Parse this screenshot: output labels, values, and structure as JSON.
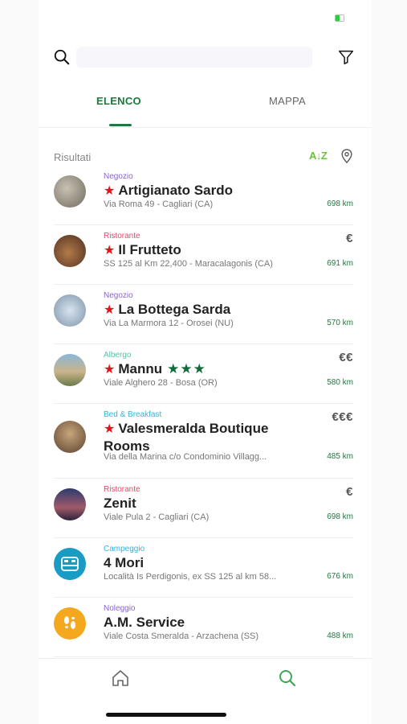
{
  "search": {
    "placeholder": ""
  },
  "tabs": [
    {
      "label": "ELENCO",
      "active": true
    },
    {
      "label": "MAPPA",
      "active": false
    }
  ],
  "results": {
    "label": "Risultati",
    "sort_label": "A↓Z"
  },
  "colors": {
    "accent": "#1c7a3e",
    "negozio": "#8a63d2",
    "ristorante": "#e14b6f",
    "albergo": "#5bc0a8",
    "bnb": "#36b3d9",
    "campeggio": "#36b3d9",
    "noleggio": "#8a63d2",
    "highlight_star": "#e3131b"
  },
  "items": [
    {
      "category": "Negozio",
      "name": "Artigianato Sardo",
      "featured": true,
      "hotel_stars": "",
      "address": "Via Roma 49 - Cagliari (CA)",
      "price": "",
      "distance": "698 km",
      "thumb": "photo"
    },
    {
      "category": "Ristorante",
      "name": "Il Frutteto",
      "featured": true,
      "hotel_stars": "",
      "address": "SS 125 al Km 22,400 - Maracalagonis (CA)",
      "price": "€",
      "distance": "691 km",
      "thumb": "photo"
    },
    {
      "category": "Negozio",
      "name": "La Bottega Sarda",
      "featured": true,
      "hotel_stars": "",
      "address": "Via La Marmora 12 - Orosei (NU)",
      "price": "",
      "distance": "570 km",
      "thumb": "photo"
    },
    {
      "category": "Albergo",
      "name": "Mannu",
      "featured": true,
      "hotel_stars": "★★★",
      "address": "Viale Alghero 28 - Bosa (OR)",
      "price": "€€",
      "distance": "580 km",
      "thumb": "photo"
    },
    {
      "category": "Bed & Breakfast",
      "name": "Valesmeralda Boutique Rooms",
      "featured": true,
      "hotel_stars": "",
      "address": "Via della Marina c/o Condominio Villagg...",
      "price": "€€€",
      "distance": "485 km",
      "thumb": "photo"
    },
    {
      "category": "Ristorante",
      "name": "Zenit",
      "featured": false,
      "hotel_stars": "",
      "address": "Viale Pula 2 - Cagliari (CA)",
      "price": "€",
      "distance": "698 km",
      "thumb": "photo"
    },
    {
      "category": "Campeggio",
      "name": "4 Mori",
      "featured": false,
      "hotel_stars": "",
      "address": "Località Is Perdigonis, ex SS 125 al km 58...",
      "price": "",
      "distance": "676 km",
      "thumb": "bed-icon"
    },
    {
      "category": "Noleggio",
      "name": "A.M. Service",
      "featured": false,
      "hotel_stars": "",
      "address": "Viale Costa Smeralda - Arzachena (SS)",
      "price": "",
      "distance": "488 km",
      "thumb": "footprints-icon"
    }
  ]
}
